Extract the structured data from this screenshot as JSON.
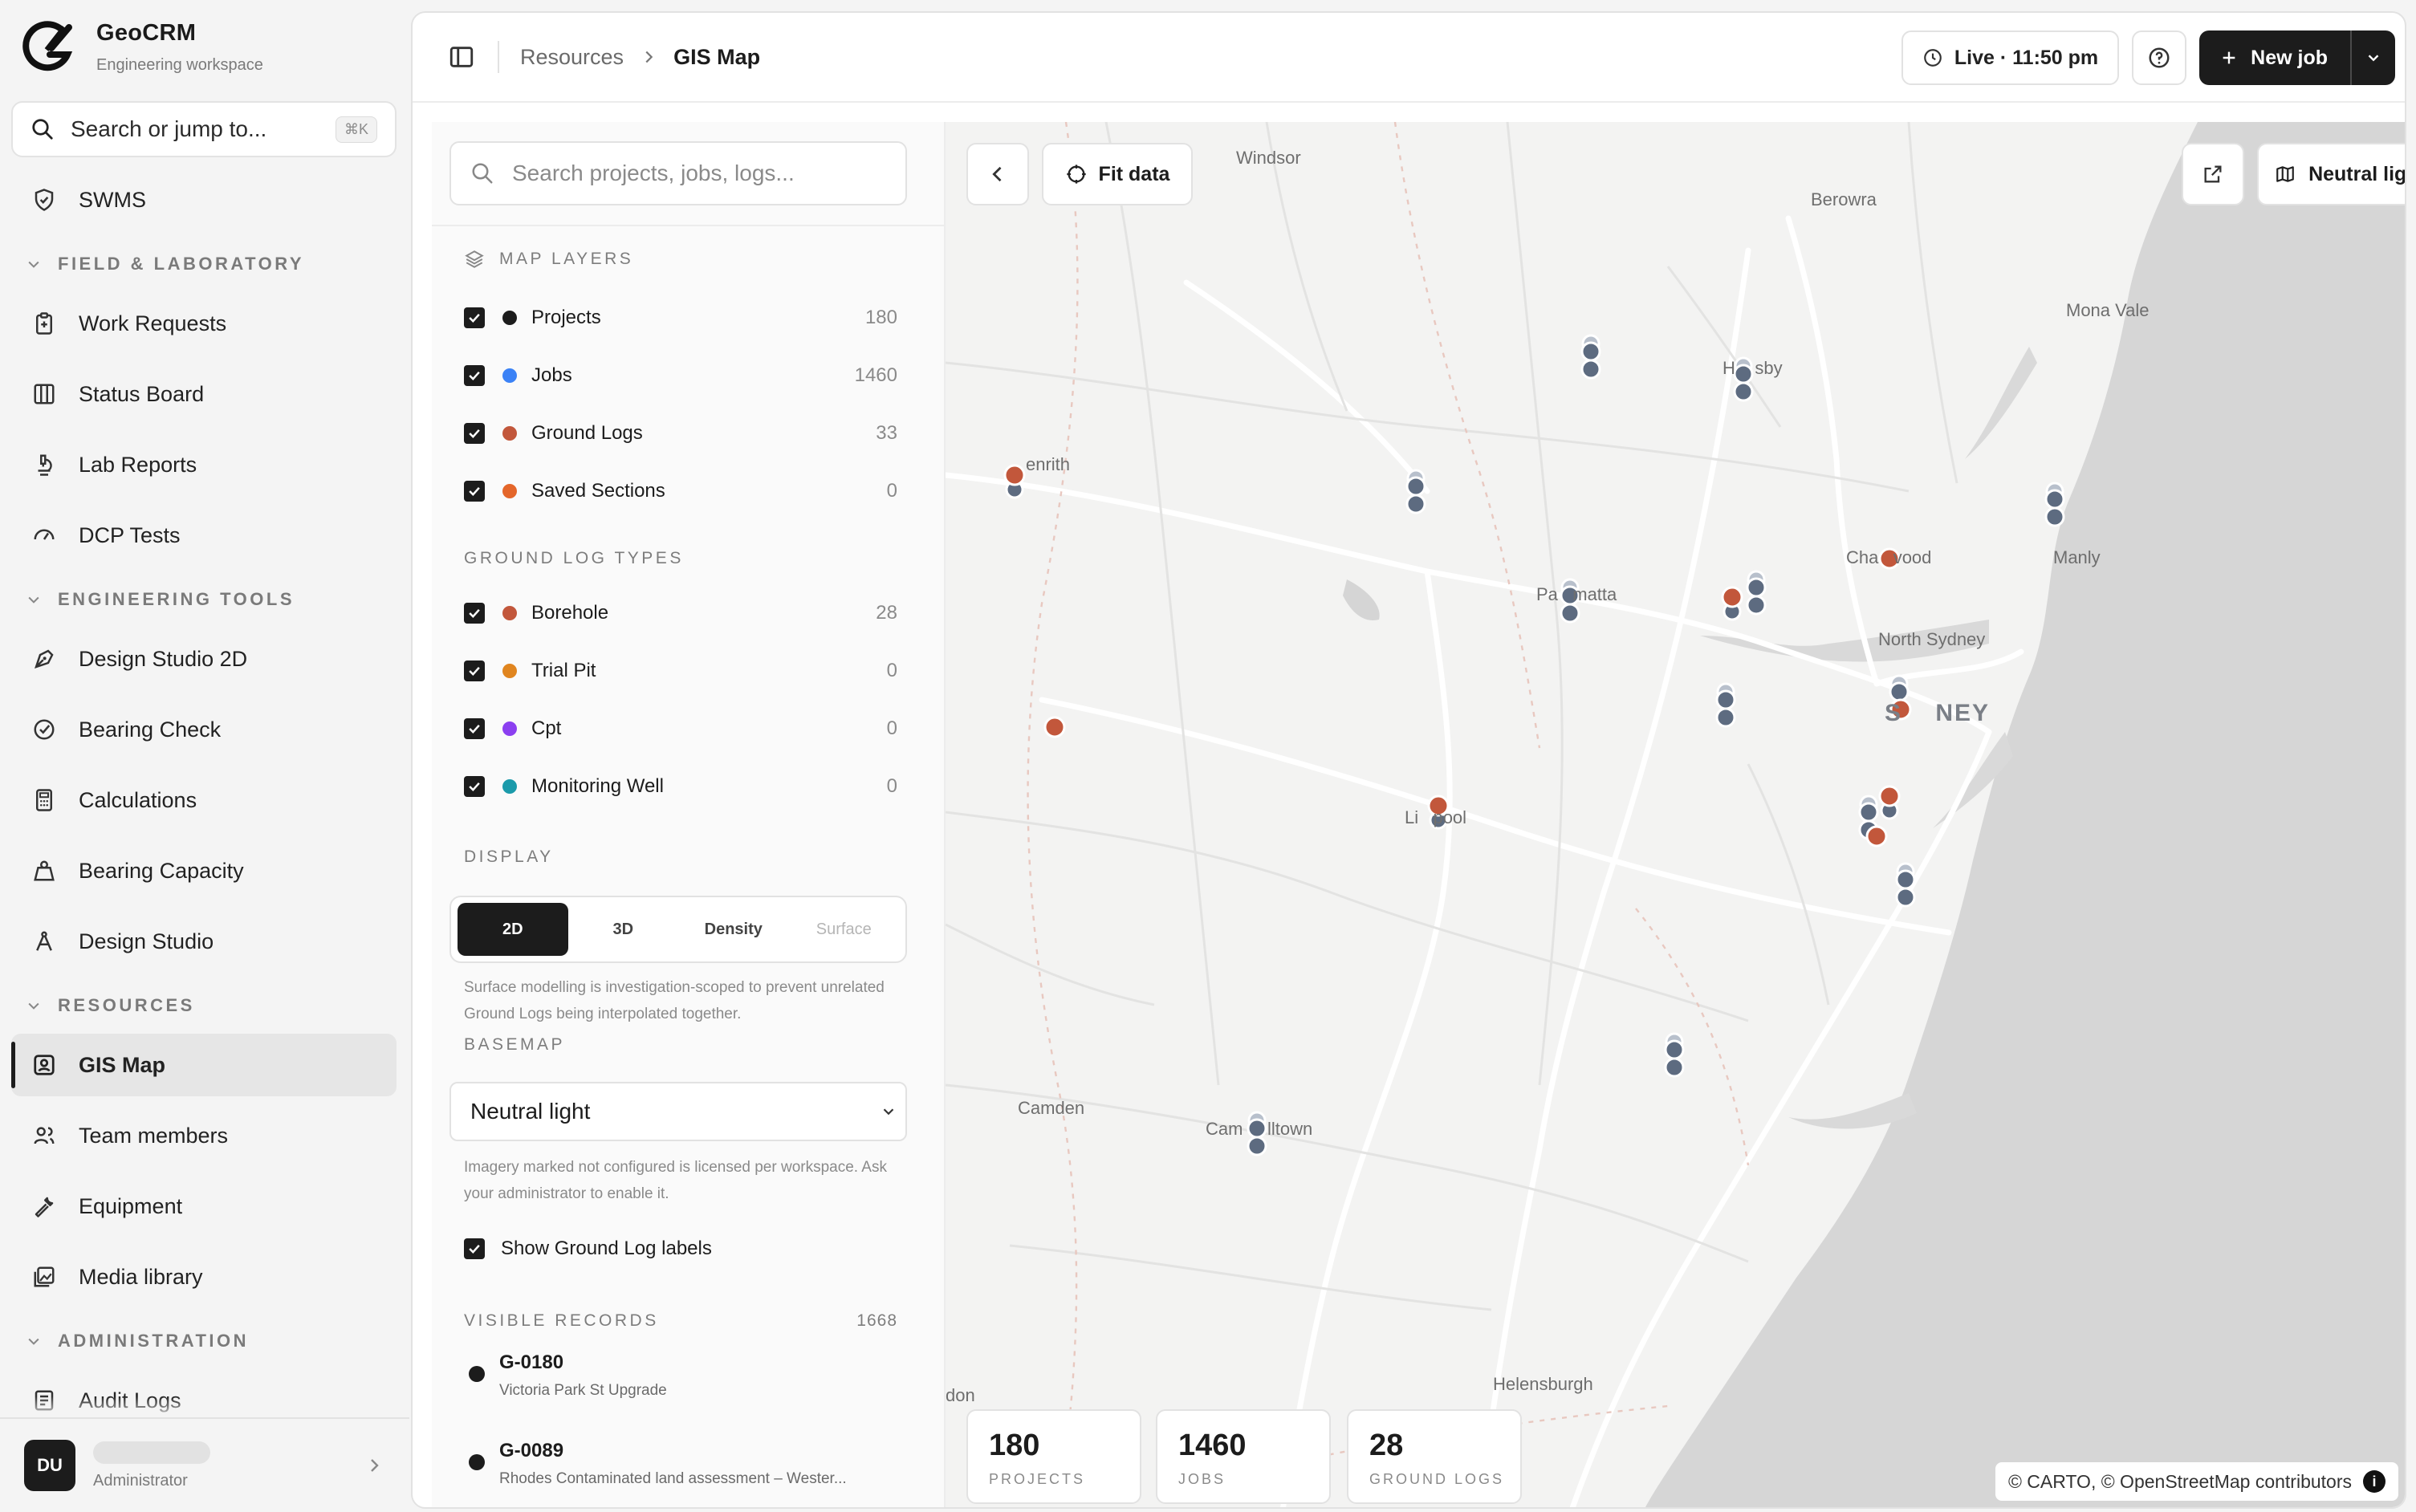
{
  "brand": {
    "name": "GeoCRM",
    "subtitle": "Engineering workspace"
  },
  "search": {
    "label": "Search or jump to...",
    "shortcut": "⌘K"
  },
  "nav": {
    "swms": "SWMS",
    "sections": {
      "field": "FIELD & LABORATORY",
      "tools": "ENGINEERING TOOLS",
      "resources": "RESOURCES",
      "admin": "ADMINISTRATION"
    },
    "items": {
      "work_requests": "Work Requests",
      "status_board": "Status Board",
      "lab_reports": "Lab Reports",
      "dcp_tests": "DCP Tests",
      "design_studio_2d": "Design Studio 2D",
      "bearing_check": "Bearing Check",
      "calculations": "Calculations",
      "bearing_capacity": "Bearing Capacity",
      "design_studio": "Design Studio",
      "gis_map": "GIS Map",
      "team_members": "Team members",
      "equipment": "Equipment",
      "media_library": "Media library",
      "audit_logs": "Audit Logs"
    }
  },
  "user": {
    "initials": "DU",
    "role": "Administrator"
  },
  "topbar": {
    "breadcrumb_parent": "Resources",
    "breadcrumb_current": "GIS Map",
    "live": "Live · 11:50 pm",
    "new_job": "New job"
  },
  "panel": {
    "search_placeholder": "Search projects, jobs, logs...",
    "map_layers_heading": "MAP LAYERS",
    "layers": [
      {
        "name": "Projects",
        "count": "180",
        "color": "#1c1c1c"
      },
      {
        "name": "Jobs",
        "count": "1460",
        "color": "#3b82f6"
      },
      {
        "name": "Ground Logs",
        "count": "33",
        "color": "#c2573b"
      },
      {
        "name": "Saved Sections",
        "count": "0",
        "color": "#e4662a"
      }
    ],
    "ground_types_heading": "GROUND LOG TYPES",
    "ground_types": [
      {
        "name": "Borehole",
        "count": "28",
        "color": "#c2573b"
      },
      {
        "name": "Trial Pit",
        "count": "0",
        "color": "#e0851f"
      },
      {
        "name": "Cpt",
        "count": "0",
        "color": "#8b3ff0"
      },
      {
        "name": "Monitoring Well",
        "count": "0",
        "color": "#1b9aaa"
      }
    ],
    "display_heading": "DISPLAY",
    "display_options": [
      "2D",
      "3D",
      "Density",
      "Surface"
    ],
    "display_note": "Surface modelling is investigation-scoped to prevent unrelated Ground Logs being interpolated together.",
    "basemap_heading": "BASEMAP",
    "basemap_value": "Neutral light",
    "basemap_note": "Imagery marked not configured is licensed per workspace. Ask your administrator to enable it.",
    "show_labels": "Show Ground Log labels",
    "visible_heading": "VISIBLE RECORDS",
    "visible_count": "1668",
    "records": [
      {
        "code": "G-0180",
        "desc": "Victoria Park St Upgrade"
      },
      {
        "code": "G-0089",
        "desc": "Rhodes Contaminated land assessment – Wester..."
      }
    ]
  },
  "map": {
    "fit_data": "Fit data",
    "style_button": "Neutral light",
    "places": {
      "windsor": "Windsor",
      "berowra": "Berowra",
      "mona_vale": "Mona Vale",
      "hornsby": "H    sby",
      "penrith": "enrith",
      "chatswood": "Cha   vood",
      "manly": "Manly",
      "parramatta": "Pa   matta",
      "north_sydney": "North Sydney",
      "sydney": "S    NEY",
      "liverpool": "Li   pool",
      "camden": "Camden",
      "campbelltown": "Cam     lltown",
      "helensburgh": "Helensburgh",
      "don": "don"
    },
    "stats": [
      {
        "value": "180",
        "label": "PROJECTS"
      },
      {
        "value": "1460",
        "label": "JOBS"
      },
      {
        "value": "28",
        "label": "GROUND LOGS"
      }
    ],
    "attribution": "© CARTO, © OpenStreetMap contributors"
  }
}
